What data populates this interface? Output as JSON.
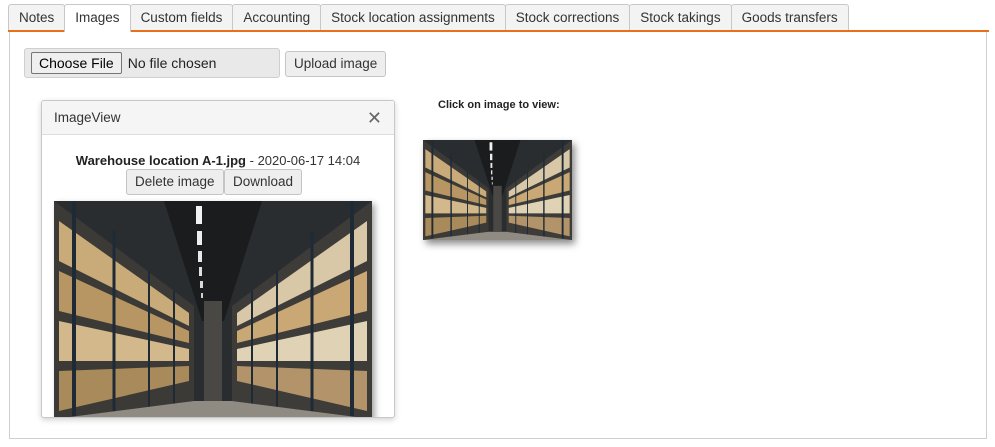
{
  "tabs": [
    {
      "label": "Notes",
      "active": false
    },
    {
      "label": "Images",
      "active": true
    },
    {
      "label": "Custom fields",
      "active": false
    },
    {
      "label": "Accounting",
      "active": false
    },
    {
      "label": "Stock location assignments",
      "active": false
    },
    {
      "label": "Stock corrections",
      "active": false
    },
    {
      "label": "Stock takings",
      "active": false
    },
    {
      "label": "Goods transfers",
      "active": false
    }
  ],
  "colors": {
    "accent": "#e8701a"
  },
  "upload": {
    "choose_label": "Choose File",
    "no_file_text": "No file chosen",
    "upload_label": "Upload image"
  },
  "viewer": {
    "title": "ImageView",
    "close_icon": "close-icon",
    "filename": "Warehouse location A-1.jpg",
    "separator": " - ",
    "datetime": "2020-06-17 14:04",
    "delete_label": "Delete image",
    "download_label": "Download",
    "image_subject": "warehouse-aisle-photo"
  },
  "gallery": {
    "hint": "Click on image to view:",
    "thumbnail_subject": "warehouse-aisle-photo"
  }
}
